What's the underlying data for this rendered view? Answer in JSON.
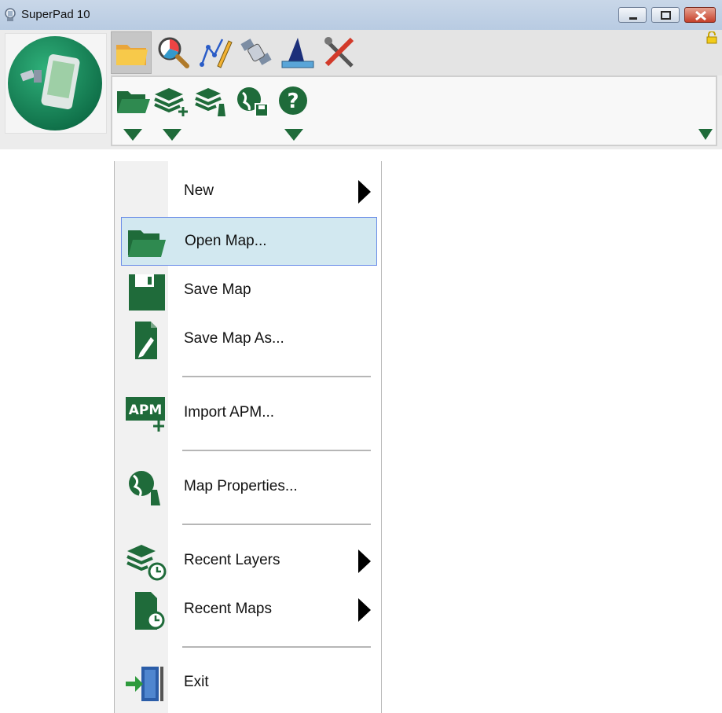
{
  "window": {
    "title": "SuperPad 10"
  },
  "colors": {
    "accent_green": "#1f6b3a",
    "highlight_bg": "#d2e8f0",
    "highlight_border": "#6b8de8"
  },
  "ribbon": {
    "tabs": [
      {
        "icon": "folder-icon",
        "active": true
      },
      {
        "icon": "map-query-icon",
        "active": false
      },
      {
        "icon": "edit-pen-icon",
        "active": false
      },
      {
        "icon": "satellite-icon",
        "active": false
      },
      {
        "icon": "survey-ruler-icon",
        "active": false
      },
      {
        "icon": "tools-icon",
        "active": false
      }
    ],
    "toolbar": [
      {
        "icon": "open-folder-icon",
        "dropdown": true
      },
      {
        "icon": "add-layers-icon",
        "dropdown": true
      },
      {
        "icon": "layer-manager-icon",
        "dropdown": false
      },
      {
        "icon": "globe-save-icon",
        "dropdown": false
      },
      {
        "icon": "help-icon",
        "dropdown": true
      }
    ]
  },
  "menu": {
    "items": [
      {
        "label": "New",
        "icon": "none",
        "submenu": true
      },
      {
        "label": "Open Map...",
        "icon": "open-folder-icon",
        "submenu": false,
        "highlighted": true
      },
      {
        "label": "Save Map",
        "icon": "floppy-disk-icon",
        "submenu": false
      },
      {
        "label": "Save Map As...",
        "icon": "document-edit-icon",
        "submenu": false
      },
      {
        "label": "Import APM...",
        "icon": "apm-import-icon",
        "submenu": false
      },
      {
        "label": "Map Properties...",
        "icon": "globe-properties-icon",
        "submenu": false
      },
      {
        "label": "Recent Layers",
        "icon": "layers-clock-icon",
        "submenu": true
      },
      {
        "label": "Recent Maps",
        "icon": "document-clock-icon",
        "submenu": true
      },
      {
        "label": "Exit",
        "icon": "exit-door-icon",
        "submenu": false
      }
    ],
    "apm_icon_text": "APM"
  }
}
